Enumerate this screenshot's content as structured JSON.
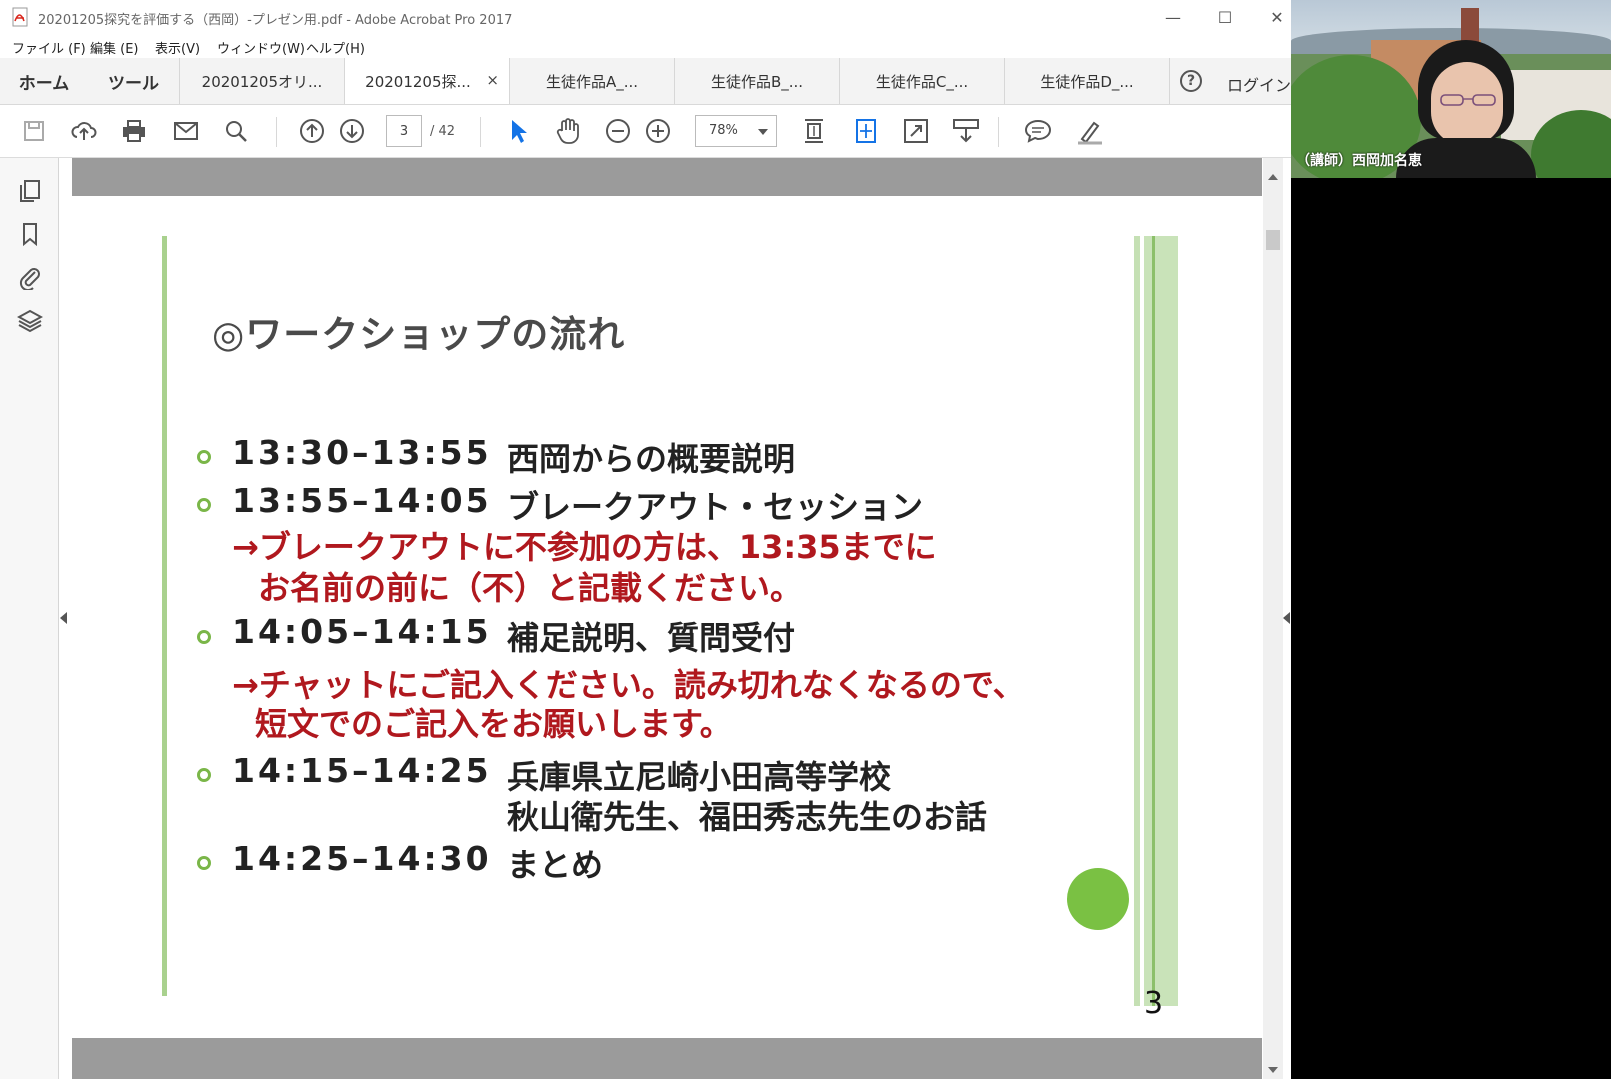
{
  "window": {
    "title": "20201205探究を評価する（西岡）-プレゼン用.pdf - Adobe Acrobat Pro 2017",
    "minimize": "—",
    "maximize": "☐",
    "close": "✕"
  },
  "menu": [
    "ファイル (F)",
    "編集 (E)",
    "表示(V)",
    "ウィンドウ(W)",
    "ヘルプ(H)"
  ],
  "tabs": {
    "home": "ホーム",
    "tools": "ツール",
    "docs": [
      "20201205オリ...",
      "20201205探...",
      "生徒作品A_...",
      "生徒作品B_...",
      "生徒作品C_...",
      "生徒作品D_..."
    ],
    "close_glyph": "×",
    "help": "?",
    "login": "ログイン"
  },
  "toolbar": {
    "page_current": "3",
    "page_total": "/ 42",
    "zoom": "78%"
  },
  "slide": {
    "title": "◎ワークショップの流れ",
    "items": [
      {
        "time": "13:30–13:55",
        "text": "西岡からの概要説明"
      },
      {
        "time": "13:55–14:05",
        "text": "ブレークアウト・セッション"
      },
      {
        "note1": "→ブレークアウトに不参加の方は、13:35までに",
        "note2": "お名前の前に（不）と記載ください。"
      },
      {
        "time": "14:05–14:15",
        "text": "補足説明、質問受付"
      },
      {
        "note1": "→チャットにご記入ください。読み切れなくなるので、",
        "note2": "短文でのご記入をお願いします。"
      },
      {
        "time": "14:15–14:25",
        "text": "兵庫県立尼崎小田高等学校",
        "text2": "秋山衛先生、福田秀志先生のお話"
      },
      {
        "time": "14:25–14:30",
        "text": "まとめ"
      }
    ],
    "page_number": "3"
  },
  "video": {
    "participant_name": "（講師）西岡加名恵"
  },
  "colors": {
    "accent_green": "#7ac143",
    "bar_green": "#a9d18e",
    "note_red": "#b0181e",
    "acrobat_blue": "#1473e6"
  }
}
